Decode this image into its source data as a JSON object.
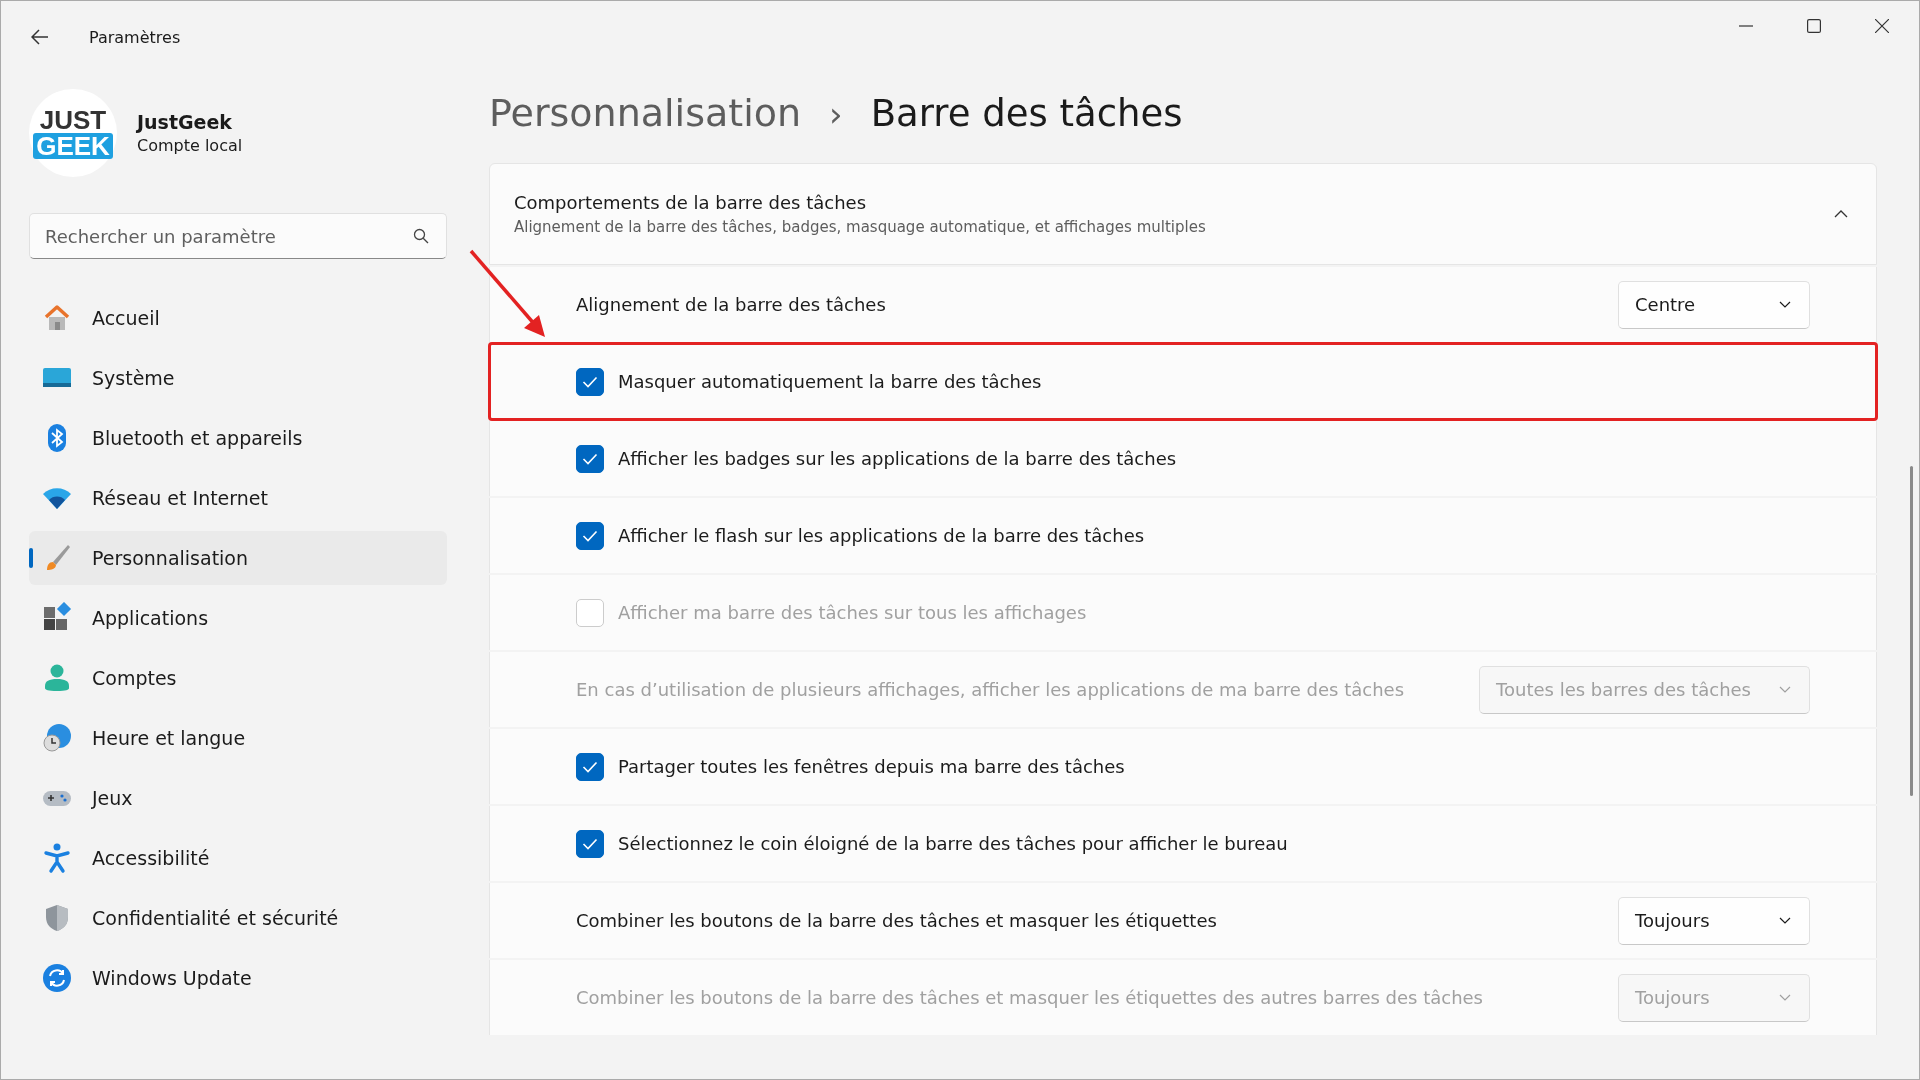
{
  "window": {
    "title": "Paramètres"
  },
  "profile": {
    "logo_top": "JUST",
    "logo_bottom": "GEEK",
    "name": "JustGeek",
    "account": "Compte local"
  },
  "search": {
    "placeholder": "Rechercher un paramètre"
  },
  "sidebar": {
    "items": [
      {
        "label": "Accueil",
        "selected": false
      },
      {
        "label": "Système",
        "selected": false
      },
      {
        "label": "Bluetooth et appareils",
        "selected": false
      },
      {
        "label": "Réseau et Internet",
        "selected": false
      },
      {
        "label": "Personnalisation",
        "selected": true
      },
      {
        "label": "Applications",
        "selected": false
      },
      {
        "label": "Comptes",
        "selected": false
      },
      {
        "label": "Heure et langue",
        "selected": false
      },
      {
        "label": "Jeux",
        "selected": false
      },
      {
        "label": "Accessibilité",
        "selected": false
      },
      {
        "label": "Confidentialité et sécurité",
        "selected": false
      },
      {
        "label": "Windows Update",
        "selected": false
      }
    ]
  },
  "breadcrumb": {
    "parent": "Personnalisation",
    "separator": "›",
    "current": "Barre des tâches"
  },
  "section": {
    "title": "Comportements de la barre des tâches",
    "subtitle": "Alignement de la barre des tâches, badges, masquage automatique, et affichages multiples",
    "expanded": true
  },
  "settings": [
    {
      "kind": "dropdown",
      "label": "Alignement de la barre des tâches",
      "value": "Centre",
      "disabled": false,
      "highlighted": false
    },
    {
      "kind": "checkbox",
      "label": "Masquer automatiquement la barre des tâches",
      "checked": true,
      "disabled": false,
      "highlighted": true
    },
    {
      "kind": "checkbox",
      "label": "Afficher les badges sur les applications de la barre des tâches",
      "checked": true,
      "disabled": false,
      "highlighted": false
    },
    {
      "kind": "checkbox",
      "label": "Afficher le flash sur les applications de la barre des tâches",
      "checked": true,
      "disabled": false,
      "highlighted": false
    },
    {
      "kind": "checkbox",
      "label": "Afficher ma barre des tâches sur tous les affichages",
      "checked": false,
      "disabled": true,
      "highlighted": false
    },
    {
      "kind": "dropdown",
      "label": "En cas d’utilisation de plusieurs affichages, afficher les applications de ma barre des tâches",
      "value": "Toutes les barres des tâches",
      "disabled": true,
      "highlighted": false
    },
    {
      "kind": "checkbox",
      "label": "Partager toutes les fenêtres depuis ma barre des tâches",
      "checked": true,
      "disabled": false,
      "highlighted": false
    },
    {
      "kind": "checkbox",
      "label": "Sélectionnez le coin éloigné de la barre des tâches pour afficher le bureau",
      "checked": true,
      "disabled": false,
      "highlighted": false
    },
    {
      "kind": "dropdown",
      "label": "Combiner les boutons de la barre des tâches et masquer les étiquettes",
      "value": "Toujours",
      "disabled": false,
      "highlighted": false
    },
    {
      "kind": "dropdown",
      "label": "Combiner les boutons de la barre des tâches et masquer les étiquettes des autres barres des tâches",
      "value": "Toujours",
      "disabled": true,
      "highlighted": false
    }
  ]
}
